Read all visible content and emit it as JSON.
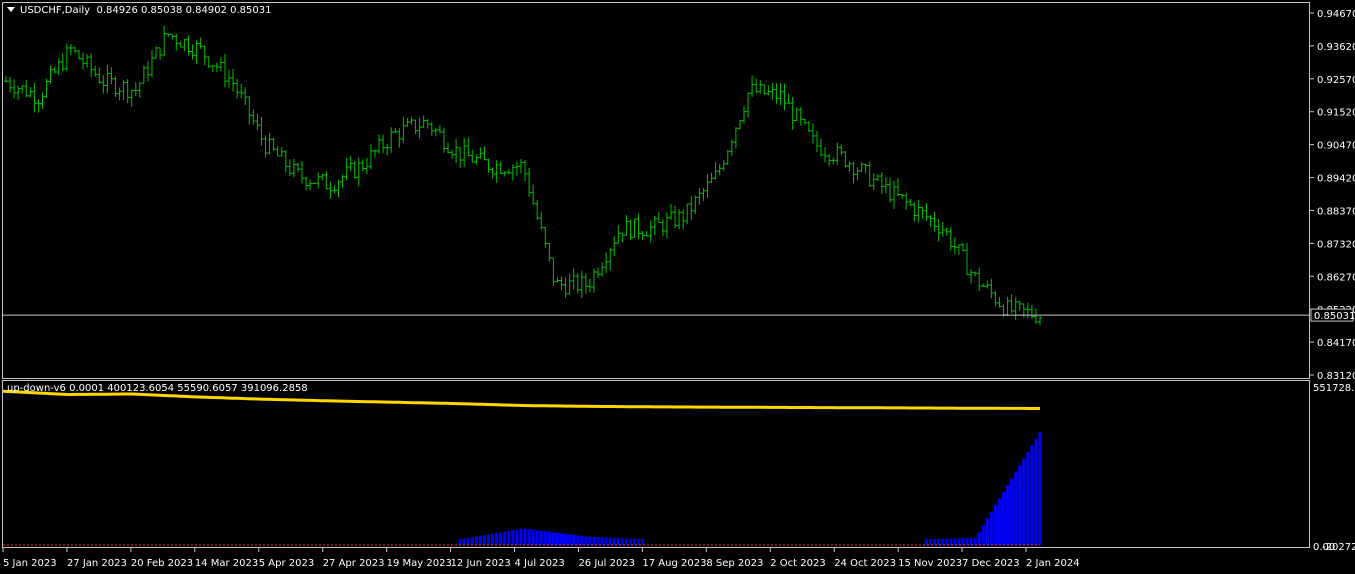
{
  "header": {
    "symbol": "USDCHF,Daily",
    "open": "0.84926",
    "high": "0.85038",
    "low": "0.84902",
    "close": "0.85031"
  },
  "price_axis": {
    "labels": [
      "0.94670",
      "0.93620",
      "0.92570",
      "0.91520",
      "0.90470",
      "0.89420",
      "0.88370",
      "0.87320",
      "0.86270",
      "0.85220",
      "0.84170",
      "0.83120"
    ],
    "current_price": "0.85031"
  },
  "indicator": {
    "name": "up-down-v6",
    "values": "0.0001 400123.6054 55590.6057 391096.2858",
    "axis_top": "551728.34",
    "axis_bottom": "-20272.77",
    "axis_bottom_overlap": "0.00"
  },
  "time_axis": {
    "labels": [
      "5 Jan 2023",
      "27 Jan 2023",
      "20 Feb 2023",
      "14 Mar 2023",
      "5 Apr 2023",
      "27 Apr 2023",
      "19 May 2023",
      "12 Jun 2023",
      "4 Jul 2023",
      "26 Jul 2023",
      "17 Aug 2023",
      "8 Sep 2023",
      "2 Oct 2023",
      "24 Oct 2023",
      "15 Nov 2023",
      "7 Dec 2023",
      "2 Jan 2024"
    ]
  },
  "colors": {
    "background": "#000000",
    "bars": "#00c000",
    "indicator_line": "#ffd700",
    "histogram": "#0000ff",
    "baseline": "#ff3030",
    "grid_text": "#ffffff",
    "frame": "#c8c8c8"
  },
  "chart_data": [
    {
      "type": "bar",
      "title": "USDCHF,Daily",
      "ylim": [
        0.8312,
        0.9467
      ],
      "x": [
        "5 Jan 2023",
        "27 Jan 2023",
        "20 Feb 2023",
        "14 Mar 2023",
        "5 Apr 2023",
        "27 Apr 2023",
        "19 May 2023",
        "12 Jun 2023",
        "4 Jul 2023",
        "26 Jul 2023",
        "17 Aug 2023",
        "8 Sep 2023",
        "2 Oct 2023",
        "24 Oct 2023",
        "15 Nov 2023",
        "7 Dec 2023",
        "2 Jan 2024"
      ],
      "series": [
        {
          "values": [
            0.925,
            0.92,
            0.935,
            0.925,
            0.922,
            0.94,
            0.935,
            0.925,
            0.905,
            0.895,
            0.892,
            0.898,
            0.908,
            0.912,
            0.902,
            0.898,
            0.898,
            0.86,
            0.86,
            0.878,
            0.878,
            0.882,
            0.895,
            0.922,
            0.92,
            0.905,
            0.9,
            0.892,
            0.885,
            0.878,
            0.862,
            0.852,
            0.8503
          ]
        }
      ]
    },
    {
      "type": "line",
      "title": "up-down-v6",
      "ylim": [
        -20272.77,
        551728.34
      ],
      "series": [
        {
          "values": [
            540000,
            528000,
            530000,
            519000,
            511000,
            505000,
            500000,
            495000,
            488000,
            485000,
            483000,
            482000,
            481000,
            480000,
            479000,
            478000,
            477000
          ]
        },
        {
          "values": [
            0,
            0,
            0,
            0,
            0,
            0,
            0,
            0,
            40000,
            10000,
            0,
            0,
            0,
            0,
            0,
            5000,
            391096
          ]
        }
      ]
    }
  ]
}
